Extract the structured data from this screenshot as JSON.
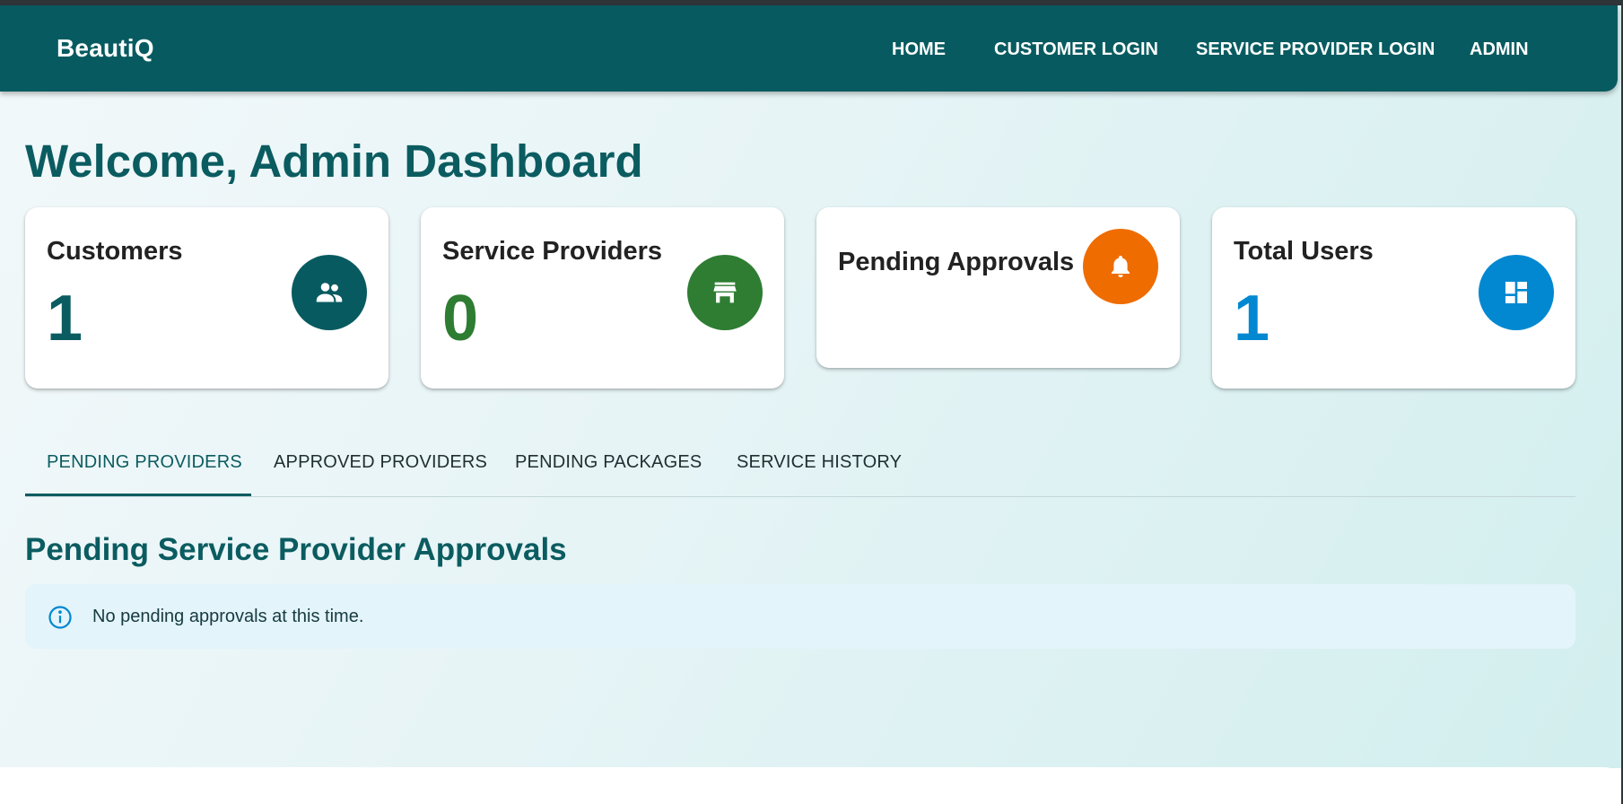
{
  "navbar": {
    "brand": "BeautiQ",
    "links": [
      "HOME",
      "CUSTOMER LOGIN",
      "SERVICE PROVIDER LOGIN",
      "ADMIN"
    ]
  },
  "page_title": "Welcome, Admin Dashboard",
  "stats": [
    {
      "label": "Customers",
      "value": "1",
      "icon": "people-icon",
      "color": "#075b60",
      "value_color": "#0b5c60"
    },
    {
      "label": "Service Providers",
      "value": "0",
      "icon": "storefront-icon",
      "color": "#2e7d32",
      "value_color": "#2e7d32"
    },
    {
      "label": "Pending Approvals",
      "value": "",
      "icon": "bell-icon",
      "color": "#ef6c00",
      "value_color": "#ef6c00"
    },
    {
      "label": "Total Users",
      "value": "1",
      "icon": "dashboard-icon",
      "color": "#0288d1",
      "value_color": "#0288d1"
    }
  ],
  "tabs": [
    "PENDING PROVIDERS",
    "APPROVED PROVIDERS",
    "PENDING PACKAGES",
    "SERVICE HISTORY"
  ],
  "active_tab": "PENDING PROVIDERS",
  "section": {
    "title": "Pending Service Provider Approvals",
    "alert": "No pending approvals at this time."
  }
}
